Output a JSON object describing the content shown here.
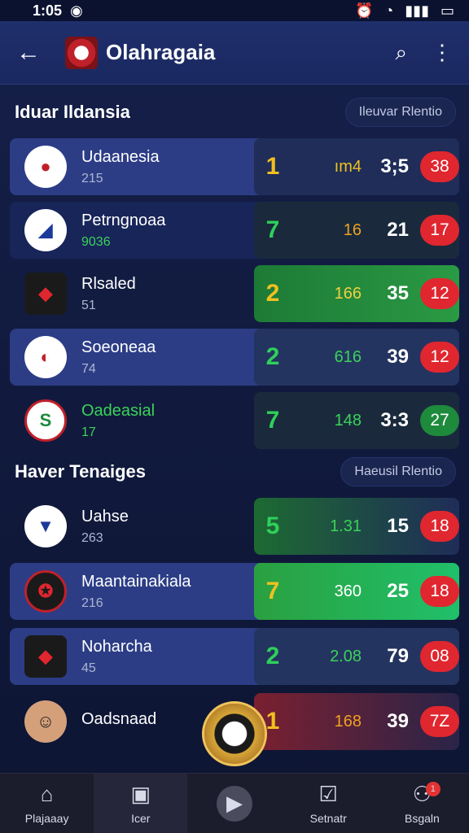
{
  "status": {
    "time": "1:05",
    "icons": [
      "cast-icon",
      "wifi-icon",
      "signal-icon",
      "battery-icon"
    ]
  },
  "appbar": {
    "title": "Olahragaia"
  },
  "sections": [
    {
      "title": "Iduar Ildansia",
      "pill": "Ileuvar Rlentio"
    },
    {
      "title": "Haver Tenaiges",
      "pill": "Haeusil Rlentio"
    }
  ],
  "rows": [
    {
      "name": "Udaanesia",
      "sub": "215",
      "rank": "1",
      "pts": "ım4",
      "score": "3;5",
      "badge": "38"
    },
    {
      "name": "Petrngnoaa",
      "sub": "9036",
      "rank": "7",
      "pts": "16",
      "score": "21",
      "badge": "17"
    },
    {
      "name": "Rlsaled",
      "sub": "51",
      "rank": "2",
      "pts": "166",
      "score": "35",
      "badge": "12"
    },
    {
      "name": "Soeoneaa",
      "sub": "74",
      "rank": "2",
      "pts": "616",
      "score": "39",
      "badge": "12"
    },
    {
      "name": "Oadeasial",
      "sub": "17",
      "rank": "7",
      "pts": "148",
      "score": "3:3",
      "badge": "27"
    },
    {
      "name": "Uahse",
      "sub": "263",
      "rank": "5",
      "pts": "1.31",
      "score": "15",
      "badge": "18"
    },
    {
      "name": "Maantainakiala",
      "sub": "216",
      "rank": "7",
      "pts": "360",
      "score": "25",
      "badge": "18"
    },
    {
      "name": "Noharcha",
      "sub": "45",
      "rank": "2",
      "pts": "2.08",
      "score": "79",
      "badge": "08"
    },
    {
      "name": "Oadsnaad",
      "sub": "",
      "rank": "1",
      "pts": "168",
      "score": "39",
      "badge": "7Z"
    }
  ],
  "nav": [
    {
      "label": "Plajaaay",
      "icon": "home-icon"
    },
    {
      "label": "Icer",
      "icon": "camera-icon"
    },
    {
      "label": "",
      "icon": "center-play-icon"
    },
    {
      "label": "Setnatr",
      "icon": "checklist-icon"
    },
    {
      "label": "Bsgaln",
      "icon": "profile-icon",
      "notification": "1"
    }
  ],
  "colors": {
    "accent_red": "#e0262f",
    "accent_green": "#1e8a3c",
    "stats_dark": "#1a2a3c",
    "yellow": "#f0c020"
  }
}
